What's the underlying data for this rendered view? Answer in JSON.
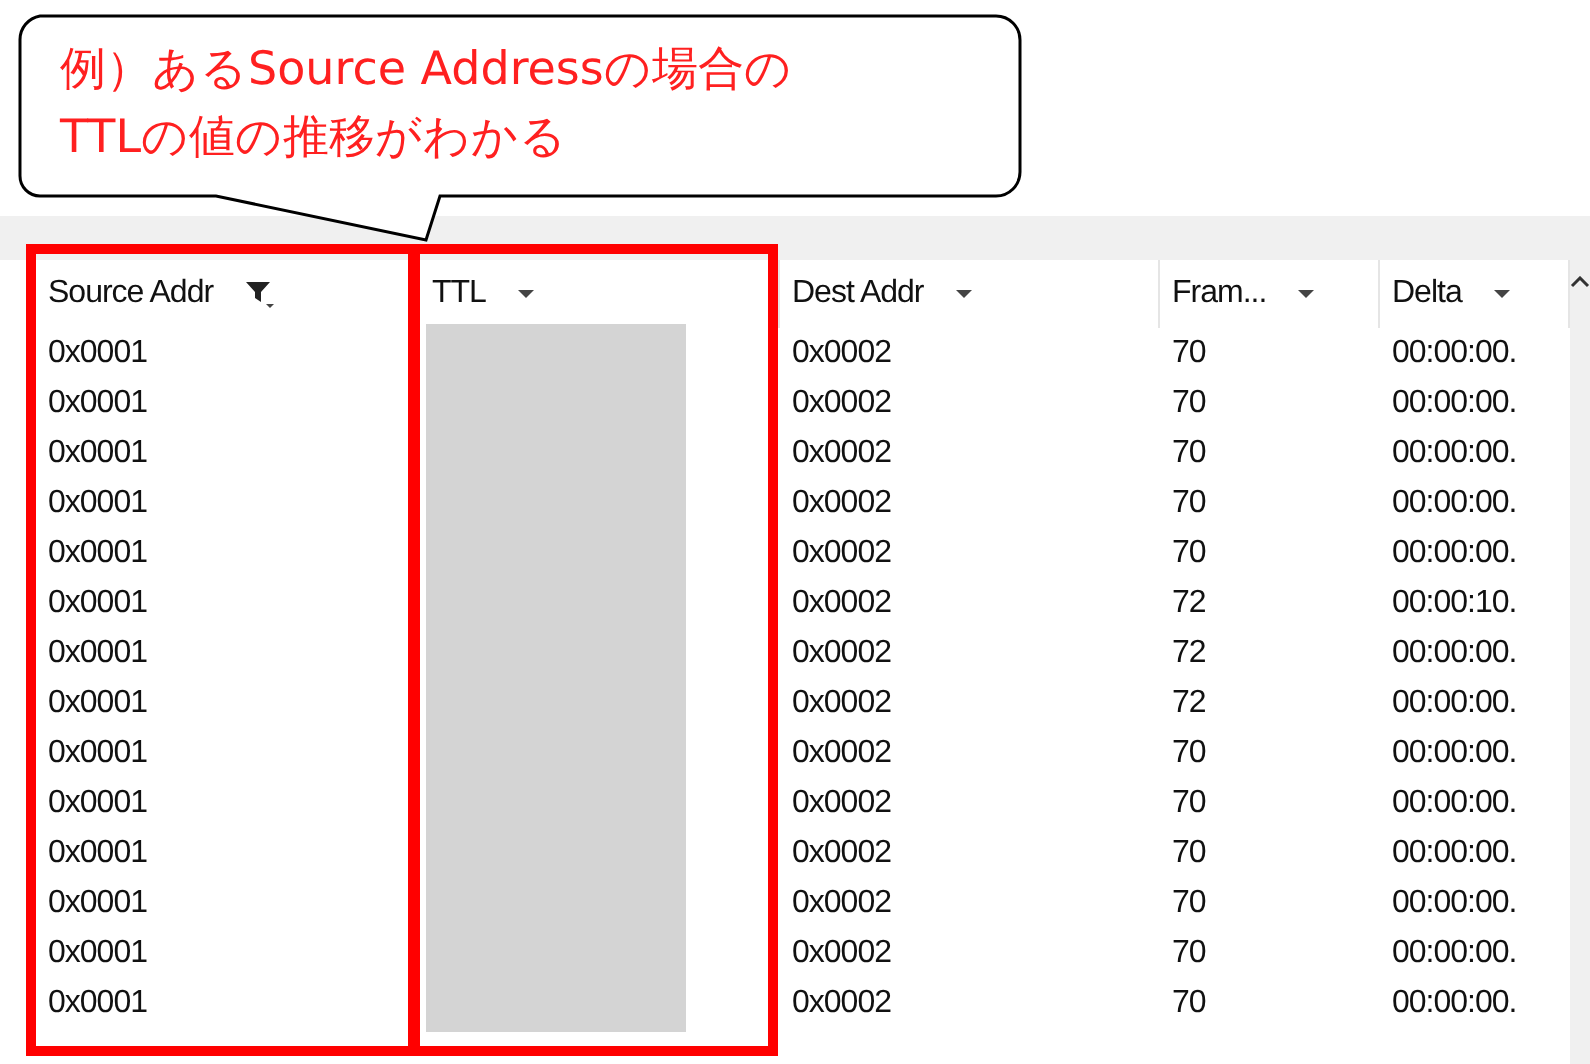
{
  "callout": {
    "lines": [
      "例）あるSource Addressの場合の",
      "TTLの値の推移がわかる"
    ]
  },
  "table": {
    "columns": [
      {
        "label": "Source Addr",
        "filter": true,
        "highlighted": true
      },
      {
        "label": "TTL",
        "filter": false,
        "highlighted": true
      },
      {
        "label": "Dest Addr",
        "filter": false,
        "highlighted": false
      },
      {
        "label": "Fram...",
        "filter": false,
        "highlighted": false
      },
      {
        "label": "Delta",
        "filter": false,
        "highlighted": false
      }
    ],
    "rows": [
      {
        "source": "0x0001",
        "dest": "0x0002",
        "frame": "70",
        "delta": "00:00:00."
      },
      {
        "source": "0x0001",
        "dest": "0x0002",
        "frame": "70",
        "delta": "00:00:00."
      },
      {
        "source": "0x0001",
        "dest": "0x0002",
        "frame": "70",
        "delta": "00:00:00."
      },
      {
        "source": "0x0001",
        "dest": "0x0002",
        "frame": "70",
        "delta": "00:00:00."
      },
      {
        "source": "0x0001",
        "dest": "0x0002",
        "frame": "70",
        "delta": "00:00:00."
      },
      {
        "source": "0x0001",
        "dest": "0x0002",
        "frame": "72",
        "delta": "00:00:10."
      },
      {
        "source": "0x0001",
        "dest": "0x0002",
        "frame": "72",
        "delta": "00:00:00."
      },
      {
        "source": "0x0001",
        "dest": "0x0002",
        "frame": "72",
        "delta": "00:00:00."
      },
      {
        "source": "0x0001",
        "dest": "0x0002",
        "frame": "70",
        "delta": "00:00:00."
      },
      {
        "source": "0x0001",
        "dest": "0x0002",
        "frame": "70",
        "delta": "00:00:00."
      },
      {
        "source": "0x0001",
        "dest": "0x0002",
        "frame": "70",
        "delta": "00:00:00."
      },
      {
        "source": "0x0001",
        "dest": "0x0002",
        "frame": "70",
        "delta": "00:00:00."
      },
      {
        "source": "0x0001",
        "dest": "0x0002",
        "frame": "70",
        "delta": "00:00:00."
      },
      {
        "source": "0x0001",
        "dest": "0x0002",
        "frame": "70",
        "delta": "00:00:00."
      }
    ]
  }
}
